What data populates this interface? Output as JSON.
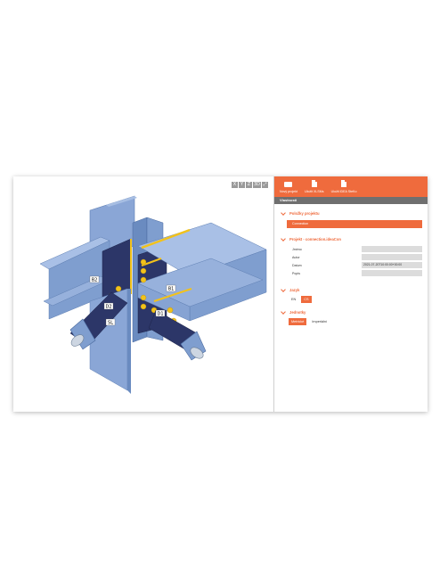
{
  "viewport": {
    "view_buttons": [
      "X",
      "Y",
      "Z",
      "3D",
      "⤢"
    ],
    "member_labels": {
      "b1": "B1",
      "b2": "B2",
      "d1": "D1",
      "d2": "D2",
      "sl": "SL"
    }
  },
  "toolbar": {
    "new_project": "Nový projekt",
    "save_xl": "Uložit XLSMs",
    "save_ideacon": "Uložit IDEA SteKo"
  },
  "section_title": "Vlastnosti",
  "groups": {
    "project_data": {
      "title": "Položky projektu",
      "selected_item": "Connection"
    },
    "project_info": {
      "title": "Projekt - connection.ideaCon",
      "fields": [
        {
          "label": "Jméno",
          "value": ""
        },
        {
          "label": "Autor",
          "value": ""
        },
        {
          "label": "Datum",
          "value": "2021-07-20T10:00:00+00:00"
        },
        {
          "label": "Popis",
          "value": ""
        }
      ]
    },
    "language": {
      "title": "Jazyk",
      "options": [
        "EN",
        "CS"
      ],
      "selected": "CS"
    },
    "units": {
      "title": "Jednotky",
      "options": [
        "Metrické",
        "Imperiální"
      ],
      "selected": "Metrické"
    }
  },
  "colors": {
    "accent": "#ef6b3d",
    "steel": "#7f9ecf",
    "plate_dark": "#2c3668",
    "weld": "#f2c21b"
  }
}
